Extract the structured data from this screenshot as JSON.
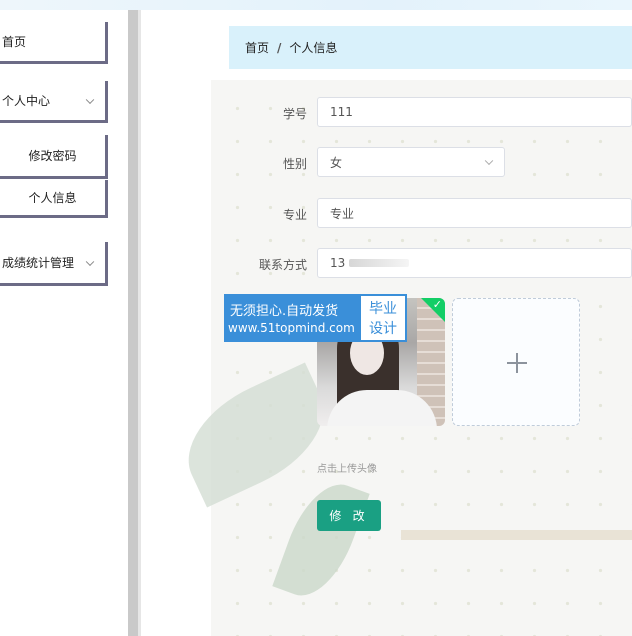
{
  "sidebar": {
    "items": [
      {
        "label": "首页"
      },
      {
        "label": "个人中心"
      },
      {
        "label": "修改密码"
      },
      {
        "label": "个人信息"
      },
      {
        "label": "成绩统计管理"
      }
    ]
  },
  "breadcrumb": {
    "home": "首页",
    "separator": "/",
    "current": "个人信息"
  },
  "form": {
    "student_id": {
      "label": "学号",
      "value": "111"
    },
    "gender": {
      "label": "性别",
      "value": "女"
    },
    "major": {
      "label": "专业",
      "placeholder": "专业"
    },
    "phone": {
      "label": "联系方式",
      "value": "13"
    },
    "upload_tip": "点击上传头像",
    "submit_label": "修 改"
  },
  "watermark": {
    "line1": "无须担心.自动发货",
    "line2": "www.51topmind.com",
    "tag1": "毕业",
    "tag2": "设计"
  },
  "colors": {
    "accent": "#1aa083",
    "breadcrumb_bg": "#d9f1fb",
    "sidebar_border": "#6c6b86",
    "upload_success": "#13ce66"
  },
  "icons": {
    "dropdown": "chevron-down-icon",
    "add": "plus-icon",
    "success": "check-icon"
  }
}
